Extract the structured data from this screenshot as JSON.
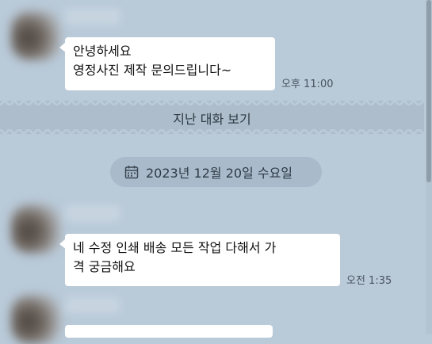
{
  "messages": [
    {
      "text": "안녕하세요\n영정사진 제작 문의드립니다~",
      "time": "오후 11:00"
    },
    {
      "text": "네 수정 인쇄 배송 모든 작업 다해서 가\n격 궁금해요",
      "time": "오전 1:35"
    }
  ],
  "history": {
    "label": "지난 대화 보기"
  },
  "date_divider": {
    "label": "2023년 12월 20일 수요일",
    "icon": "calendar-icon"
  },
  "colors": {
    "background": "#b9cad9",
    "bubble": "#ffffff",
    "date_pill": "#a9bbcb"
  }
}
